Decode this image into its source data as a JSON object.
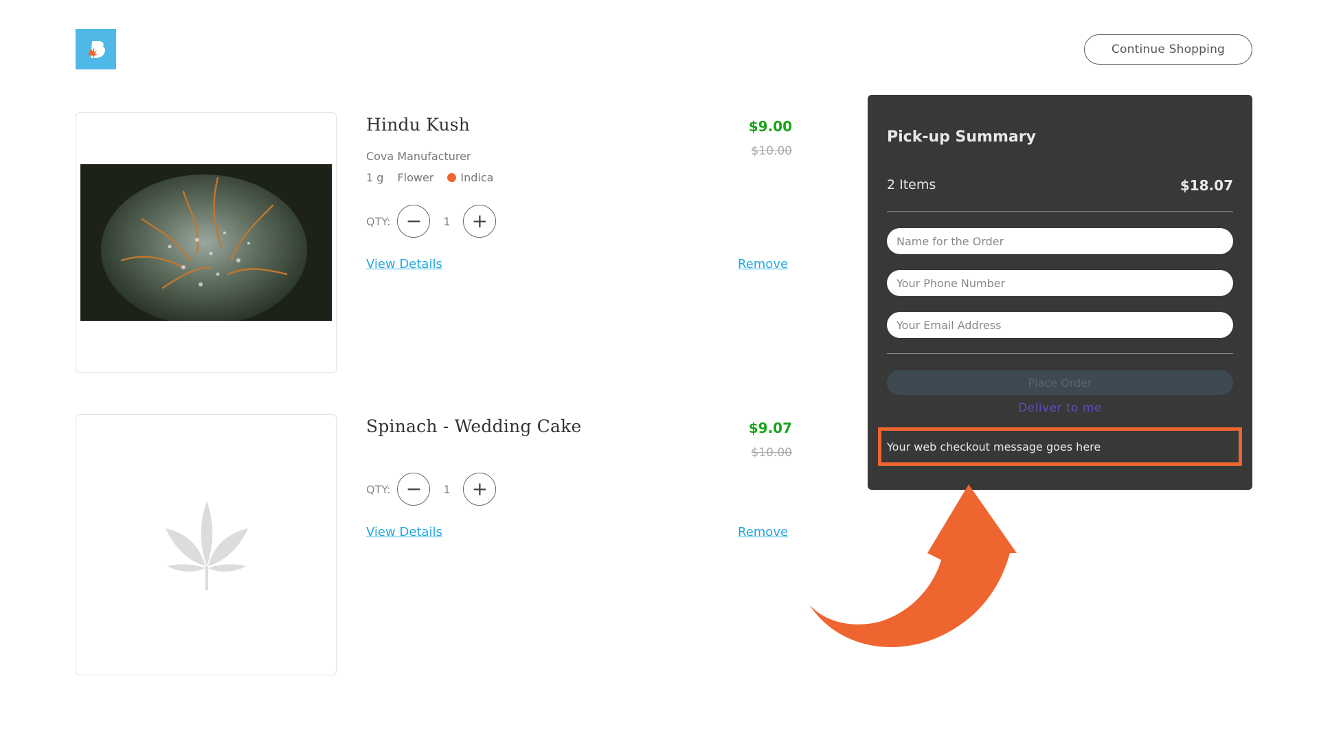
{
  "header": {
    "logo_icon": "brand-logo-icon",
    "continue_label": "Continue Shopping"
  },
  "cart": {
    "items": [
      {
        "name": "Hindu Kush",
        "manufacturer": "Cova Manufacturer",
        "size": "1 g",
        "category": "Flower",
        "strain": "Indica",
        "qty_label": "QTY:",
        "qty": "1",
        "price": "$9.00",
        "old_price": "$10.00",
        "view_details": "View Details",
        "remove": "Remove"
      },
      {
        "name": "Spinach - Wedding Cake",
        "qty_label": "QTY:",
        "qty": "1",
        "price": "$9.07",
        "old_price": "$10.00",
        "view_details": "View Details",
        "remove": "Remove"
      }
    ]
  },
  "summary": {
    "title": "Pick-up Summary",
    "items_count": "2 Items",
    "total": "$18.07",
    "name_placeholder": "Name for the Order",
    "phone_placeholder": "Your Phone Number",
    "email_placeholder": "Your Email Address",
    "place_order": "Place Order",
    "deliver": "Deliver to me",
    "checkout_message": "Your web checkout message goes here"
  },
  "colors": {
    "brand": "#4fb8e6",
    "accent": "#ef6530",
    "price_green": "#1aa31a",
    "link_blue": "#1fa8e0",
    "panel_bg": "#383838"
  }
}
